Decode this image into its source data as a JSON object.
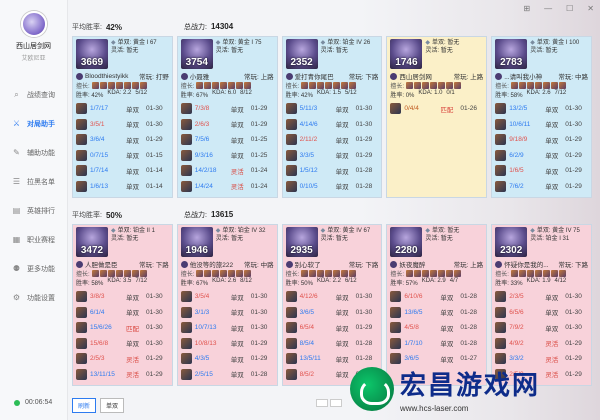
{
  "sidebar": {
    "username": "西山居剑网",
    "subtitle": "艾欧尼亚",
    "items": [
      {
        "label": "战绩查询",
        "icon": "search-icon",
        "active": false
      },
      {
        "label": "对局助手",
        "icon": "swords-icon",
        "active": true
      },
      {
        "label": "辅助功能",
        "icon": "wrench-icon",
        "active": false
      },
      {
        "label": "拉黑名单",
        "icon": "block-icon",
        "active": false
      },
      {
        "label": "英雄排行",
        "icon": "chart-icon",
        "active": false
      },
      {
        "label": "职业赛程",
        "icon": "calendar-icon",
        "active": false
      },
      {
        "label": "更多功能",
        "icon": "grid-icon",
        "active": false
      },
      {
        "label": "功能设置",
        "icon": "gear-icon",
        "active": false
      }
    ],
    "time": "00:06:54"
  },
  "window_controls": [
    "⊞",
    "—",
    "☐",
    "✕"
  ],
  "team1": {
    "winrate_label": "平均胜率:",
    "winrate": "42%",
    "power_label": "总战力:",
    "power": "14304",
    "cards": [
      {
        "color": "blue",
        "level": "3669",
        "rank1": "单双: 黄金 I 67",
        "rank2": "灵活: 暂无",
        "name": "Bloodthiestyikk",
        "pos": "常玩: 打野",
        "tags": "擅长:",
        "wr": "胜率: 42%",
        "kda": "KDA: 2.2",
        "score": "5/12",
        "matches": [
          [
            "1/7/17",
            "win",
            "单双",
            "01-30"
          ],
          [
            "3/5/1",
            "lose",
            "单双",
            "01-30"
          ],
          [
            "3/6/4",
            "win",
            "单双",
            "01-29"
          ],
          [
            "0/7/15",
            "win",
            "单双",
            "01-15"
          ],
          [
            "1/7/14",
            "win",
            "单双",
            "01-14"
          ],
          [
            "1/6/13",
            "win",
            "单双",
            "01-14"
          ]
        ]
      },
      {
        "color": "blue",
        "level": "3754",
        "rank1": "单双: 黄金 I 75",
        "rank2": "灵活: 暂无",
        "name": "小聂雅",
        "pos": "常玩: 上路",
        "tags": "擅长:",
        "wr": "胜率: 67%",
        "kda": "KDA: 6.0",
        "score": "8/12",
        "matches": [
          [
            "7/3/8",
            "lose",
            "单双",
            "01-29"
          ],
          [
            "2/6/3",
            "lose",
            "单双",
            "01-29"
          ],
          [
            "7/5/6",
            "win",
            "单双",
            "01-25"
          ],
          [
            "9/3/16",
            "win",
            "单双",
            "01-25"
          ],
          [
            "14/2/18",
            "win",
            "灵活",
            "01-24"
          ],
          [
            "1/4/24",
            "win",
            "灵活",
            "01-24"
          ]
        ]
      },
      {
        "color": "blue",
        "level": "2352",
        "rank1": "单双: 铂金 IV 26",
        "rank2": "灵活: 暂无",
        "name": "爱打青你尾巴",
        "pos": "常玩: 下路",
        "tags": "擅长:",
        "wr": "胜率: 42%",
        "kda": "KDA: 1.5",
        "score": "5/12",
        "matches": [
          [
            "5/11/3",
            "win",
            "单双",
            "01-30"
          ],
          [
            "4/14/6",
            "win",
            "单双",
            "01-30"
          ],
          [
            "2/11/2",
            "lose",
            "单双",
            "01-29"
          ],
          [
            "3/3/5",
            "win",
            "单双",
            "01-29"
          ],
          [
            "1/5/12",
            "win",
            "单双",
            "01-28"
          ],
          [
            "0/10/5",
            "win",
            "单双",
            "01-28"
          ]
        ]
      },
      {
        "color": "yellow",
        "level": "1746",
        "rank1": "单双: 暂无",
        "rank2": "灵活: 暂无",
        "name": "西山居剑网",
        "pos": "常玩: 上路",
        "tags": "擅长:",
        "wr": "胜率: 0%",
        "kda": "KDA: 1.0",
        "score": "0/1",
        "matches": [
          [
            "0/4/4",
            "na",
            "匹配",
            "01-26"
          ]
        ]
      },
      {
        "color": "blue",
        "level": "2783",
        "rank1": "单双: 黄金 I 100",
        "rank2": "灵活: 暂无",
        "name": "...请叫我小神",
        "pos": "常玩: 中路",
        "tags": "擅长:",
        "wr": "胜率: 58%",
        "kda": "KDA: 2.6",
        "score": "7/12",
        "matches": [
          [
            "13/2/5",
            "win",
            "单双",
            "01-30"
          ],
          [
            "10/6/11",
            "win",
            "单双",
            "01-30"
          ],
          [
            "9/18/9",
            "lose",
            "单双",
            "01-29"
          ],
          [
            "6/2/9",
            "win",
            "单双",
            "01-29"
          ],
          [
            "1/6/5",
            "lose",
            "单双",
            "01-29"
          ],
          [
            "7/6/2",
            "win",
            "单双",
            "01-29"
          ]
        ]
      }
    ]
  },
  "team2": {
    "winrate_label": "平均胜率:",
    "winrate": "50%",
    "power_label": "总战力:",
    "power": "13615",
    "cards": [
      {
        "color": "pink",
        "level": "3472",
        "rank1": "单双: 铂金 II 1",
        "rank2": "灵活: 暂无",
        "name": "人胆做是臣",
        "pos": "常玩: 下路",
        "tags": "擅长:",
        "wr": "胜率: 58%",
        "kda": "KDA: 3.5",
        "score": "7/12",
        "matches": [
          [
            "3/8/3",
            "lose",
            "单双",
            "01-30"
          ],
          [
            "6/1/4",
            "win",
            "单双",
            "01-30"
          ],
          [
            "15/6/26",
            "win",
            "匹配",
            "01-30"
          ],
          [
            "15/6/8",
            "lose",
            "单双",
            "01-30"
          ],
          [
            "2/5/3",
            "lose",
            "灵活",
            "01-29"
          ],
          [
            "13/11/15",
            "win",
            "灵活",
            "01-29"
          ]
        ]
      },
      {
        "color": "pink",
        "level": "1946",
        "rank1": "单双: 铂金 IV 32",
        "rank2": "灵活: 暂无",
        "name": "他没等的旅222",
        "pos": "常玩: 中路",
        "tags": "擅长:",
        "wr": "胜率: 67%",
        "kda": "KDA: 2.6",
        "score": "8/12",
        "matches": [
          [
            "3/5/4",
            "lose",
            "单双",
            "01-30"
          ],
          [
            "3/1/3",
            "win",
            "单双",
            "01-30"
          ],
          [
            "10/7/13",
            "win",
            "单双",
            "01-30"
          ],
          [
            "10/8/13",
            "lose",
            "单双",
            "01-29"
          ],
          [
            "4/3/5",
            "win",
            "单双",
            "01-29"
          ],
          [
            "2/5/15",
            "win",
            "单双",
            "01-28"
          ]
        ]
      },
      {
        "color": "pink",
        "level": "2935",
        "rank1": "单双: 黄金 IV 67",
        "rank2": "灵活: 暂无",
        "name": "别心软了",
        "pos": "常玩: 下路",
        "tags": "擅长:",
        "wr": "胜率: 50%",
        "kda": "KDA: 2.2",
        "score": "6/12",
        "matches": [
          [
            "4/12/6",
            "lose",
            "单双",
            "01-30"
          ],
          [
            "3/6/5",
            "win",
            "单双",
            "01-30"
          ],
          [
            "6/5/4",
            "lose",
            "单双",
            "01-29"
          ],
          [
            "8/5/4",
            "win",
            "单双",
            "01-28"
          ],
          [
            "13/5/11",
            "win",
            "单双",
            "01-28"
          ],
          [
            "8/5/2",
            "lose",
            "单双",
            "01-26"
          ]
        ]
      },
      {
        "color": "pink",
        "level": "2280",
        "rank1": "单双: 暂无",
        "rank2": "灵活: 暂无",
        "name": "妖夜魔醉",
        "pos": "常玩: 上路",
        "tags": "擅长:",
        "wr": "胜率: 57%",
        "kda": "KDA: 2.9",
        "score": "4/7",
        "matches": [
          [
            "6/10/6",
            "lose",
            "单双",
            "01-28"
          ],
          [
            "13/6/5",
            "win",
            "单双",
            "01-28"
          ],
          [
            "4/5/8",
            "lose",
            "单双",
            "01-28"
          ],
          [
            "1/7/10",
            "win",
            "单双",
            "01-28"
          ],
          [
            "3/6/5",
            "win",
            "单双",
            "01-27"
          ]
        ]
      },
      {
        "color": "pink",
        "level": "2302",
        "rank1": "单双: 黄金 IV 75",
        "rank2": "灵活: 铂金 I 31",
        "name": "怀疑你是我的...",
        "pos": "常玩: 下路",
        "tags": "擅长:",
        "wr": "胜率: 33%",
        "kda": "KDA: 1.9",
        "score": "4/12",
        "matches": [
          [
            "2/3/5",
            "lose",
            "单双",
            "01-30"
          ],
          [
            "6/5/6",
            "lose",
            "单双",
            "01-30"
          ],
          [
            "7/9/2",
            "lose",
            "单双",
            "01-30"
          ],
          [
            "4/9/2",
            "lose",
            "灵活",
            "01-29"
          ],
          [
            "3/3/2",
            "win",
            "灵活",
            "01-29"
          ],
          [
            "2/5/9",
            "lose",
            "灵活",
            "01-29"
          ]
        ]
      }
    ]
  },
  "bottom": {
    "tab1": "刷新",
    "tab2": "单双"
  },
  "watermark": {
    "title": "宏昌游戏网",
    "url": "www.hcs-laser.com"
  }
}
